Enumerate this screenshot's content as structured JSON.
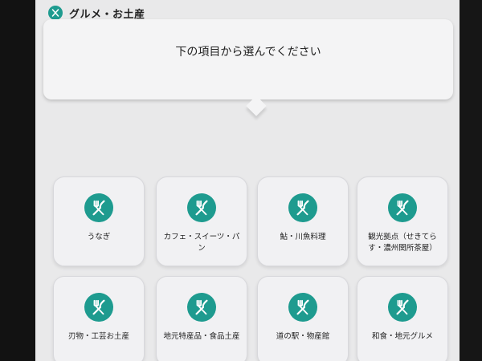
{
  "header": {
    "icon": "fork-knife-icon",
    "title": "グルメ・お土産"
  },
  "prompt": "下の項目から選んでください",
  "tiles": [
    {
      "label": "うなぎ",
      "icon": "fork-knife-icon"
    },
    {
      "label": "カフェ・スイーツ・パン",
      "icon": "fork-knife-icon"
    },
    {
      "label": "鮎・川魚料理",
      "icon": "fork-knife-icon"
    },
    {
      "label": "観光拠点（せきてらす・濃州関所茶屋）",
      "icon": "fork-knife-icon"
    },
    {
      "label": "刃物・工芸お土産",
      "icon": "fork-knife-icon"
    },
    {
      "label": "地元特産品・食品土産",
      "icon": "fork-knife-icon"
    },
    {
      "label": "道の駅・物産館",
      "icon": "fork-knife-icon"
    },
    {
      "label": "和食・地元グルメ",
      "icon": "fork-knife-icon"
    }
  ],
  "colors": {
    "accent": "#1e9b8f",
    "tile_bg": "#f1f1f3",
    "screen_bg": "#e9e9ea"
  }
}
